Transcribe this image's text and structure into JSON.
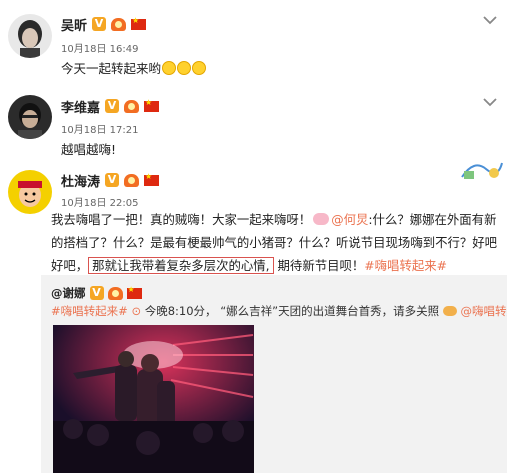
{
  "posts": [
    {
      "username": "吴昕",
      "time": "10月18日 16:49",
      "text": "今天一起转起来哟",
      "verified_badge": "V",
      "emoji_count": 3
    },
    {
      "username": "李维嘉",
      "time": "10月18日 17:21",
      "text": "越唱越嗨!",
      "verified_badge": "V"
    },
    {
      "username": "杜海涛",
      "time": "10月18日 22:05",
      "verified_badge": "V",
      "text_part1": "我去嗨唱了一把！真的贼嗨！大家一起来嗨呀！",
      "mention": "@何炅",
      "text_part2": ":什么？娜娜在外面有新的搭档了？什么？是最有梗最帅气的小猪哥？什么？听说节目现场嗨到不行？好吧好吧，",
      "boxed_text": "那就让我带着复杂多层次的心情,",
      "text_part3": "期待新节目呗！",
      "hashtag": "#嗨唱转起来#"
    }
  ],
  "repost": {
    "username": "@谢娜",
    "hashtag": "#嗨唱转起来#",
    "play_text": "今晚8:10分，",
    "quote": "“娜么吉祥”天团的出道舞台首秀，请多关照",
    "hashtag2": "@嗨唱转起来"
  },
  "colors": {
    "link": "#eb7350",
    "vbadge": "#f5a623",
    "repost_bg": "#f2f2f2",
    "highlight_box": "#d9534f"
  },
  "icons": [
    "chevron-down-icon",
    "verified-icon",
    "level-crown-icon",
    "china-flag-icon",
    "pig-emoji-icon",
    "play-icon",
    "clap-emoji-icon"
  ]
}
